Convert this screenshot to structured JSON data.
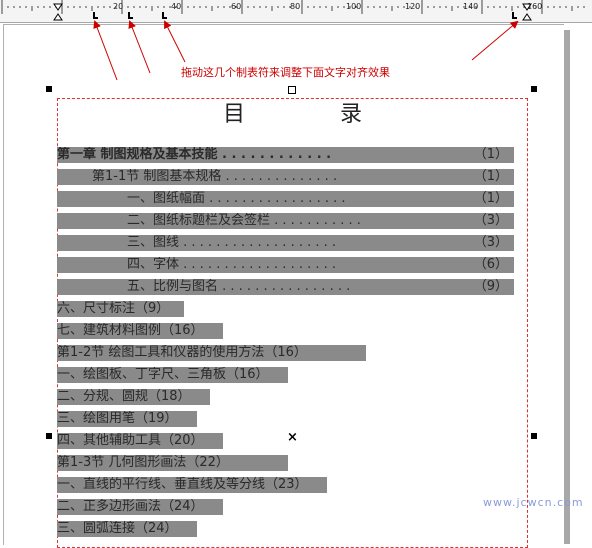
{
  "ruler": {
    "ticks": [
      "20",
      "40",
      "60",
      "80",
      "100",
      "120",
      "140",
      "160"
    ]
  },
  "annotation": "拖动这几个制表符来调整下面文字对齐效果",
  "document": {
    "title": "目 录",
    "entries": [
      {
        "label": "第一章  制图规格及基本技能",
        "dots": ". . . . . . . . . . . .",
        "page": "（1）"
      },
      {
        "label": "第1-1节  制图基本规格",
        "dots": ". . . . . . . . . . . . . .",
        "page": "（1）"
      },
      {
        "label": "一、图纸幅面",
        "dots": ". . . . . . . . . . . . . . . . .",
        "page": "（1）"
      },
      {
        "label": "二、图纸标题栏及会签栏",
        "dots": ". . . . . . . . . . .",
        "page": "（3）"
      },
      {
        "label": "三、图线",
        "dots": ". . . . . . . . . . . . . . . . . . .",
        "page": "（3）"
      },
      {
        "label": "四、字体",
        "dots": ". . . . . . . . . . . . . . . . . . .",
        "page": "（6）"
      },
      {
        "label": "五、比例与图名",
        "dots": ". . . . . . . . . . . . . . . .",
        "page": "（9）"
      },
      {
        "label": "六、尺寸标注（9）"
      },
      {
        "label": "七、建筑材料图例（16）"
      },
      {
        "label": "第1-2节  绘图工具和仪器的使用方法（16）"
      },
      {
        "label": "一、绘图板、丁字尺、三角板（16）"
      },
      {
        "label": "二、分规、圆规（18）"
      },
      {
        "label": "三、绘图用笔（19）"
      },
      {
        "label": "四、其他辅助工具（20）"
      },
      {
        "label": "第1-3节  几何图形画法（22）"
      },
      {
        "label": "一、直线的平行线、垂直线及等分线（23）"
      },
      {
        "label": "二、正多边形画法（24）"
      },
      {
        "label": "三、圆弧连接（24）"
      }
    ]
  },
  "watermark": "www.jcwcn.com",
  "colors": {
    "highlight": "#8a8a8a",
    "frame": "#e03030",
    "annotation": "#cc0000"
  }
}
